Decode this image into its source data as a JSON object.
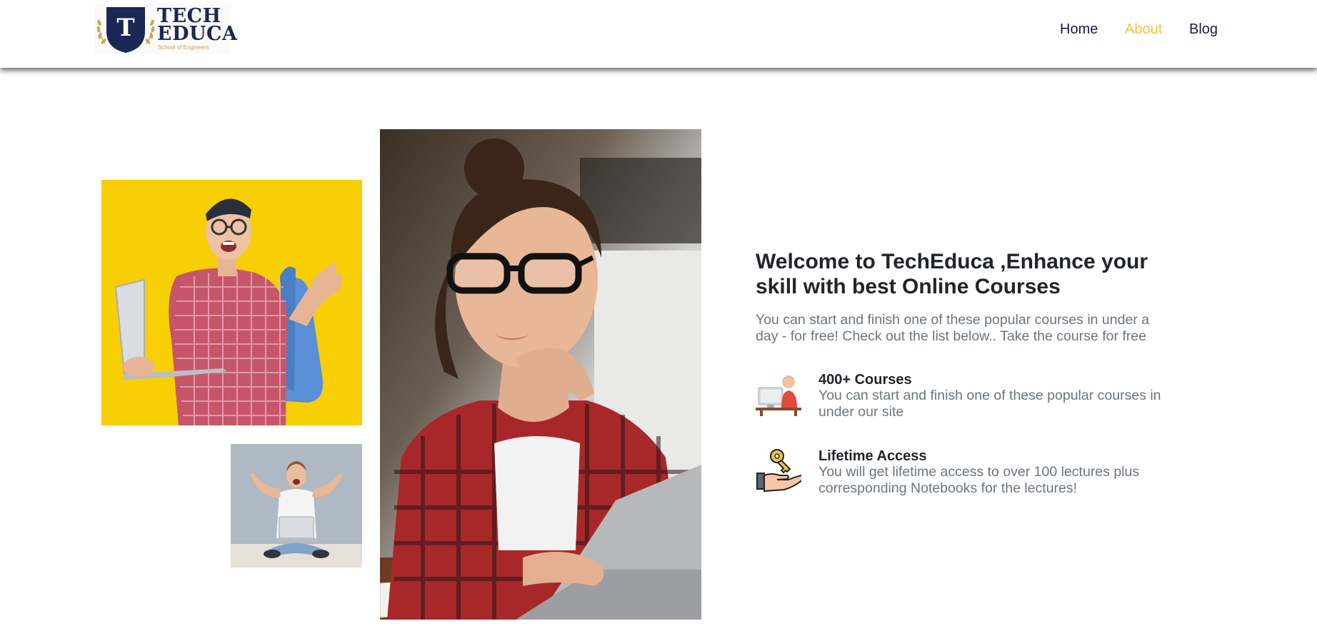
{
  "brand": {
    "logo_letter": "T",
    "name_line1": "TECH",
    "name_line2": "EDUCA",
    "tagline": "School of Engineers",
    "primary_color": "#1b2754",
    "gold_color": "#c9a84a"
  },
  "nav": {
    "items": [
      {
        "label": "Home",
        "active": false
      },
      {
        "label": "About",
        "active": true
      },
      {
        "label": "Blog",
        "active": false
      }
    ],
    "text_color": "#1a1a4e",
    "active_color": "#f4c33c"
  },
  "hero": {
    "title": "Welcome to TechEduca ,Enhance your skill with best Online Courses",
    "subtitle": "You can start and finish one of these popular courses in under a day - for free! Check out the list below.. Take the course for free"
  },
  "features": [
    {
      "icon": "computer-student-icon",
      "title": "400+ Courses",
      "text": "You can start and finish one of these popular courses in under our site"
    },
    {
      "icon": "hand-key-icon",
      "title": "Lifetime Access",
      "text": "You will get lifetime access to over 100 lectures plus corresponding Notebooks for the lectures!"
    }
  ],
  "images": {
    "photo_1": "student-with-laptop-on-yellow-background",
    "photo_2": "excited-man-sitting-with-laptop",
    "photo_3": "woman-with-glasses-studying-on-laptop"
  }
}
